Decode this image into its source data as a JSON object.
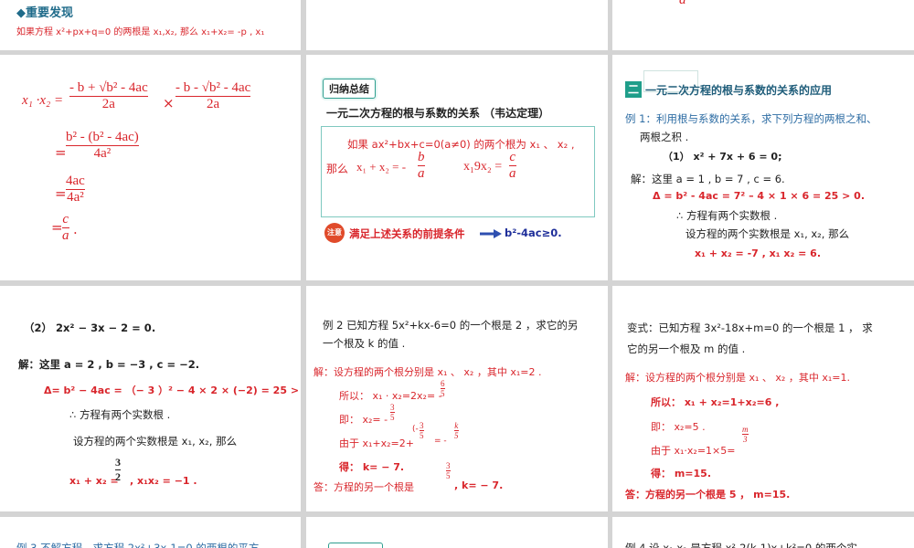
{
  "s1": {
    "heading": "◆重要发现",
    "line": "如果方程 x²+px+q=0 的两根是 x₁,x₂, 那么 x₁+x₂= -p , x₁"
  },
  "s3": {
    "frag": "a"
  },
  "s4": {
    "lhs": "x₁ ·x₂ =",
    "n1": "- b + √b² - 4ac",
    "d1": "2a",
    "times": "×",
    "n2": "- b - √b² - 4ac",
    "d2": "2a",
    "eq": "=",
    "n3": "b² - (b² - 4ac)",
    "d3": "4a²",
    "n4": "4ac",
    "d4": "4a²",
    "n5": "c",
    "d5": "a",
    "dot": "."
  },
  "s5": {
    "tag": "归纳总结",
    "title": "一元二次方程的根与系数的关系 （韦达定理）",
    "line1": "如果 ax²+bx+c=0(a≠0) 的两个根为 x₁ 、 x₂ ,",
    "nasm": "那么",
    "sum_lhs": "x₁ + x₂ = -",
    "sum_n": "b",
    "sum_d": "a",
    "prod_lhs": "x₁9x₂ =",
    "prod_n": "c",
    "prod_d": "a",
    "note_icon": "注意",
    "note": "满足上述关系的前提条件",
    "cond": "b²-4ac≥0."
  },
  "s6": {
    "num": "二",
    "title": "一元二次方程的根与系数的关系的应用",
    "ex1": "例 1：利用根与系数的关系，求下列方程的两根之和、",
    "ex1b": "两根之积 .",
    "eq1": "（1） x² + 7x + 6 = 0;",
    "sol": "解：这里  a = 1 , b = 7 , c = 6.",
    "delta": "Δ = b² - 4ac = 7² – 4 × 1 × 6 = 25 > 0.",
    "two": "∴ 方程有两个实数根 .",
    "let": "设方程的两个实数根是  x₁, x₂,  那么",
    "res": "x₁ + x₂ = -7 ,  x₁ x₂ = 6."
  },
  "s7": {
    "eq2": "（2） 2x² − 3x −  2 = 0.",
    "sol": "解：这里  a = 2 , b = −3 , c = −2.",
    "delta": "Δ= b² − 4ac = （− 3 ）² − 4 × 2 × (−2) = 25 > 0,",
    "two": "∴ 方程有两个实数根 .",
    "let": "设方程的两个实数根是  x₁, x₂,  那么",
    "frac_n": "3",
    "frac_d": "2",
    "res_a": "x₁ + x₂ =",
    "res_b": ", x₁x₂ = −1 ."
  },
  "s8": {
    "ex": "例 2  已知方程 5x²+kx-6=0 的一个根是 2 ，求它的另",
    "exb": "一个根及 k 的值 .",
    "sol": "解：设方程的两个根分别是 x₁ 、 x₂ ，其中 x₁=2 .",
    "so": "所以： x₁ · x₂=2x₂= -",
    "so_n": "6",
    "so_d": "5",
    "ji": "即： x₂= -",
    "ji_n": "3",
    "ji_d": "5",
    "you": "由于 x₁+x₂=2+",
    "you_m": "(-",
    "you_n": "3",
    "you_d": "5",
    "you_eq": "=  -",
    "you_kn": "k",
    "you_kd": "5",
    "de": "得： k= − 7.",
    "ans": "答：方程的另一个根是",
    "ans_n": "3",
    "ans_d": "5",
    "ans_k": ",  k= − 7."
  },
  "s9": {
    "ex": "变式：已知方程 3x²-18x+m=0 的一个根是 1 ， 求",
    "exb": "它的另一个根及 m 的值 .",
    "sol": "解：设方程的两个根分别是 x₁ 、 x₂ ，其中 x₁=1.",
    "so": "所以：  x₁ + x₂=1+x₂=6 ,",
    "ji": "即： x₂=5 .",
    "you": "由于 x₁·x₂=1×5=",
    "you_n": "m",
    "you_d": "3",
    "de": "得： m=15.",
    "ans": "答：方程的另一个根是 5 ，  m=15."
  },
  "s10": {
    "frag": "例 3   不解方程，求方程 2x²+3x-1=0 的两根的平方"
  },
  "s12": {
    "frag": "例 4   设 x₁,x₂ 是方程 x²-2(k-1)x+k²=0 的两个实"
  }
}
